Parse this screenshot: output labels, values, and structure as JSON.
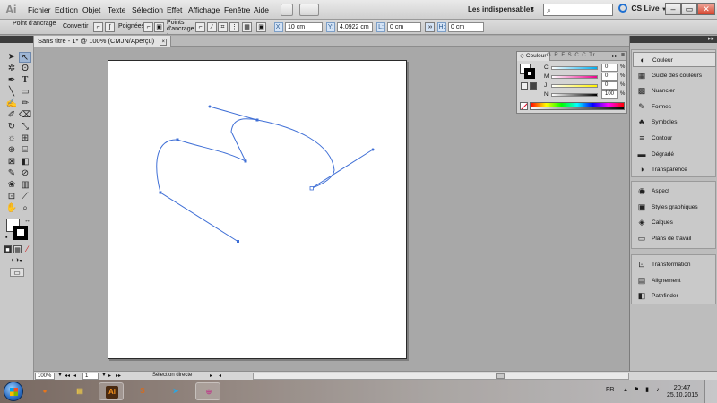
{
  "app": {
    "logo": "Ai"
  },
  "menu": [
    "Fichier",
    "Edition",
    "Objet",
    "Texte",
    "Sélection",
    "Effet",
    "Affichage",
    "Fenêtre",
    "Aide"
  ],
  "workspace": {
    "label": "Les indispensables"
  },
  "cs_live": {
    "label": "CS Live"
  },
  "control_bar": {
    "point_label": "Point d'ancrage",
    "convert_label": "Convertir :",
    "handles_label": "Poignées :",
    "anchor_points_label": "Points d'ancrage :",
    "x_label": "X:",
    "x_value": "10 cm",
    "y_label": "Y:",
    "y_value": "4.0922 cm",
    "l_label": "L:",
    "l_value": "0 cm",
    "h_label": "H:",
    "h_value": "0 cm"
  },
  "document": {
    "tab_title": "Sans titre - 1* @ 100% (CMJN/Aperçu)",
    "close_glyph": "×"
  },
  "color_panel": {
    "tab": "Couleur",
    "other_tabs": "G R F S C C Tr",
    "sliders": [
      {
        "label": "C",
        "value": "0",
        "unit": "%"
      },
      {
        "label": "M",
        "value": "0",
        "unit": "%"
      },
      {
        "label": "J",
        "value": "0",
        "unit": "%"
      },
      {
        "label": "N",
        "value": "100",
        "unit": "%"
      }
    ]
  },
  "dock": {
    "group1": [
      {
        "icon": "color-icon",
        "glyph": "◐",
        "label": "Couleur"
      },
      {
        "icon": "color-guide-icon",
        "glyph": "▦",
        "label": "Guide des couleurs"
      },
      {
        "icon": "swatches-icon",
        "glyph": "▩",
        "label": "Nuancier"
      },
      {
        "icon": "brushes-icon",
        "glyph": "✎",
        "label": "Formes"
      },
      {
        "icon": "symbols-icon",
        "glyph": "♣",
        "label": "Symboles"
      },
      {
        "icon": "stroke-icon",
        "glyph": "≡",
        "label": "Contour"
      },
      {
        "icon": "gradient-icon",
        "glyph": "▬",
        "label": "Dégradé"
      },
      {
        "icon": "transparency-icon",
        "glyph": "◑",
        "label": "Transparence"
      }
    ],
    "group2": [
      {
        "icon": "appearance-icon",
        "glyph": "◉",
        "label": "Aspect"
      },
      {
        "icon": "graphic-styles-icon",
        "glyph": "▣",
        "label": "Styles graphiques"
      },
      {
        "icon": "layers-icon",
        "glyph": "◈",
        "label": "Calques"
      },
      {
        "icon": "artboards-icon",
        "glyph": "▭",
        "label": "Plans de travail"
      }
    ],
    "group3": [
      {
        "icon": "transform-icon",
        "glyph": "⊡",
        "label": "Transformation"
      },
      {
        "icon": "align-icon",
        "glyph": "▤",
        "label": "Alignement"
      },
      {
        "icon": "pathfinder-icon",
        "glyph": "◧",
        "label": "Pathfinder"
      }
    ]
  },
  "status_bar": {
    "zoom": "100%",
    "page": "1",
    "tool": "Sélection directe"
  },
  "taskbar": {
    "apps": [
      {
        "name": "firefox",
        "glyph": "●",
        "color": "#e8751a"
      },
      {
        "name": "explorer",
        "glyph": "▤",
        "color": "#e8c54a"
      },
      {
        "name": "illustrator",
        "glyph": "Ai",
        "color": "#f7931e"
      },
      {
        "name": "app-s",
        "glyph": "S",
        "color": "#d86b1c"
      },
      {
        "name": "telegram",
        "glyph": "➤",
        "color": "#2ca5e0"
      },
      {
        "name": "app-web",
        "glyph": "⊕",
        "color": "#b94a8b"
      }
    ],
    "lang": "FR",
    "time": "20:47",
    "date": "25.10.2015"
  },
  "colors": {
    "path_stroke": "#3f6fd6",
    "accent_active": "#9fb6d4"
  }
}
